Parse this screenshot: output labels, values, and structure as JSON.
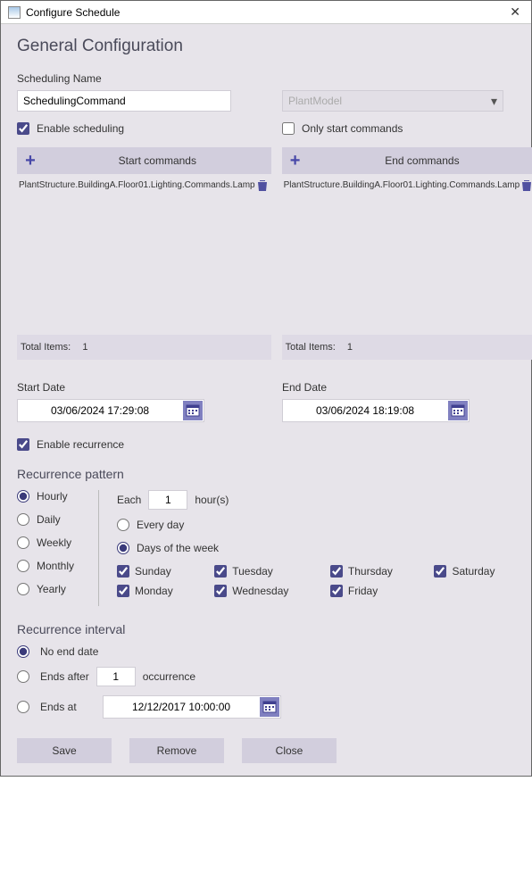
{
  "window": {
    "title": "Configure Schedule"
  },
  "header": {
    "title": "General Configuration"
  },
  "schedulingName": {
    "label": "Scheduling Name",
    "value": "SchedulingCommand"
  },
  "modelSelect": {
    "value": "PlantModel"
  },
  "enableScheduling": {
    "label": "Enable scheduling",
    "checked": true
  },
  "onlyStart": {
    "label": "Only start commands",
    "checked": false
  },
  "startCommands": {
    "header": "Start commands",
    "items": [
      "PlantStructure.BuildingA.Floor01.Lighting.Commands.Lamp"
    ],
    "totalLabel": "Total Items:",
    "totalCount": "1"
  },
  "endCommands": {
    "header": "End commands",
    "items": [
      "PlantStructure.BuildingA.Floor01.Lighting.Commands.Lamp"
    ],
    "totalLabel": "Total Items:",
    "totalCount": "1"
  },
  "startDate": {
    "label": "Start Date",
    "value": "03/06/2024 17:29:08"
  },
  "endDate": {
    "label": "End Date",
    "value": "03/06/2024 18:19:08"
  },
  "enableRecurrence": {
    "label": "Enable recurrence",
    "checked": true
  },
  "recurrencePattern": {
    "title": "Recurrence pattern",
    "options": {
      "hourly": "Hourly",
      "daily": "Daily",
      "weekly": "Weekly",
      "monthly": "Monthly",
      "yearly": "Yearly"
    },
    "selected": "hourly",
    "eachLabel": "Each",
    "eachValue": "1",
    "eachUnit": "hour(s)",
    "everyDayLabel": "Every day",
    "daysOfWeekLabel": "Days of the week",
    "daysMode": "daysOfWeek",
    "days": {
      "sunday": {
        "label": "Sunday",
        "checked": true
      },
      "monday": {
        "label": "Monday",
        "checked": true
      },
      "tuesday": {
        "label": "Tuesday",
        "checked": true
      },
      "wednesday": {
        "label": "Wednesday",
        "checked": true
      },
      "thursday": {
        "label": "Thursday",
        "checked": true
      },
      "friday": {
        "label": "Friday",
        "checked": true
      },
      "saturday": {
        "label": "Saturday",
        "checked": true
      }
    }
  },
  "recurrenceInterval": {
    "title": "Recurrence interval",
    "noEndLabel": "No end date",
    "endsAfterLabel": "Ends after",
    "endsAfterValue": "1",
    "occurrenceLabel": "occurrence",
    "endsAtLabel": "Ends at",
    "endsAtValue": "12/12/2017 10:00:00",
    "selected": "noEnd"
  },
  "buttons": {
    "save": "Save",
    "remove": "Remove",
    "close": "Close"
  }
}
